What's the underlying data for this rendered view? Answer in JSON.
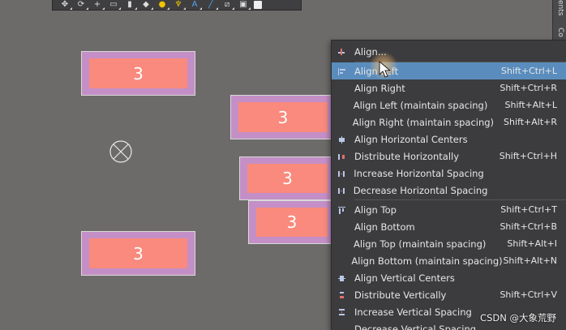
{
  "toolbar": {
    "icons": [
      "move-icon",
      "lasso-icon",
      "cross-icon",
      "rect-icon",
      "component-icon",
      "eraser-icon",
      "pin-icon",
      "net-icon",
      "text-icon",
      "line-icon",
      "edit-icon",
      "doc-icon",
      "box-icon"
    ]
  },
  "side_tabs": {
    "tab1": "ents",
    "tab2": "Co"
  },
  "components": [
    {
      "label": "3"
    },
    {
      "label": "3"
    },
    {
      "label": "3"
    },
    {
      "label": "3"
    },
    {
      "label": "3"
    }
  ],
  "menu": {
    "items": [
      {
        "label": "Align...",
        "shortcut": ""
      },
      {
        "label": "Align Left",
        "shortcut": "Shift+Ctrl+L"
      },
      {
        "label": "Align Right",
        "shortcut": "Shift+Ctrl+R"
      },
      {
        "label": "Align Left (maintain spacing)",
        "shortcut": "Shift+Alt+L"
      },
      {
        "label": "Align Right (maintain spacing)",
        "shortcut": "Shift+Alt+R"
      },
      {
        "label": "Align Horizontal Centers",
        "shortcut": ""
      },
      {
        "label": "Distribute Horizontally",
        "shortcut": "Shift+Ctrl+H"
      },
      {
        "label": "Increase Horizontal Spacing",
        "shortcut": ""
      },
      {
        "label": "Decrease Horizontal Spacing",
        "shortcut": ""
      },
      {
        "label": "Align Top",
        "shortcut": "Shift+Ctrl+T"
      },
      {
        "label": "Align Bottom",
        "shortcut": "Shift+Ctrl+B"
      },
      {
        "label": "Align Top (maintain spacing)",
        "shortcut": "Shift+Alt+I"
      },
      {
        "label": "Align Bottom (maintain spacing)",
        "shortcut": "Shift+Alt+N"
      },
      {
        "label": "Align Vertical Centers",
        "shortcut": ""
      },
      {
        "label": "Distribute Vertically",
        "shortcut": "Shift+Ctrl+V"
      },
      {
        "label": "Increase Vertical Spacing",
        "shortcut": ""
      },
      {
        "label": "Decrease Vertical Spacing",
        "shortcut": ""
      }
    ],
    "active_index": 1
  },
  "watermark": "CSDN @大象荒野",
  "colors": {
    "canvas": "#6d6b69",
    "component_body": "#c48fc6",
    "pad": "#f98a7d",
    "menu_bg": "#3c3c3e",
    "menu_highlight": "#5a8dbd"
  }
}
